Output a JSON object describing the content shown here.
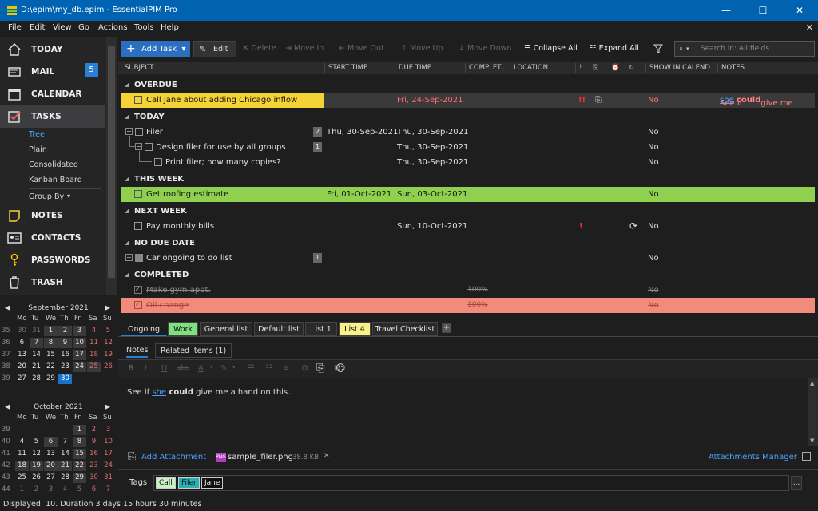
{
  "window": {
    "title": "D:\\epim\\my_db.epim - EssentialPIM Pro",
    "minimize": "—",
    "maximize": "☐",
    "close": "✕"
  },
  "menu": [
    "File",
    "Edit",
    "View",
    "Go",
    "Actions",
    "Tools",
    "Help"
  ],
  "menu_close": "✕",
  "nav": {
    "items": [
      {
        "label": "TODAY",
        "icon": "home-icon"
      },
      {
        "label": "MAIL",
        "icon": "mail-icon",
        "badge": "5"
      },
      {
        "label": "CALENDAR",
        "icon": "calendar-icon",
        "icon_text": "30"
      },
      {
        "label": "TASKS",
        "icon": "tasks-icon"
      },
      {
        "label": "NOTES",
        "icon": "notes-icon"
      },
      {
        "label": "CONTACTS",
        "icon": "contacts-icon"
      },
      {
        "label": "PASSWORDS",
        "icon": "key-icon"
      },
      {
        "label": "TRASH",
        "icon": "trash-icon"
      }
    ],
    "task_views": [
      "Tree",
      "Plain",
      "Consolidated",
      "Kanban Board"
    ],
    "group_by": "Group By",
    "group_by_arrow": "▾"
  },
  "calendars": [
    {
      "title": "September  2021",
      "dow": [
        "Mo",
        "Tu",
        "We",
        "Th",
        "Fr",
        "Sa",
        "Su"
      ],
      "weeks": [
        {
          "n": "35",
          "days": [
            "30",
            "31",
            "1",
            "2",
            "3",
            "4",
            "5"
          ]
        },
        {
          "n": "36",
          "days": [
            "6",
            "7",
            "8",
            "9",
            "10",
            "11",
            "12"
          ]
        },
        {
          "n": "37",
          "days": [
            "13",
            "14",
            "15",
            "16",
            "17",
            "18",
            "19"
          ]
        },
        {
          "n": "38",
          "days": [
            "20",
            "21",
            "22",
            "23",
            "24",
            "25",
            "26"
          ]
        },
        {
          "n": "39",
          "days": [
            "27",
            "28",
            "29",
            "30",
            "",
            "",
            ""
          ]
        }
      ]
    },
    {
      "title": "October  2021",
      "dow": [
        "Mo",
        "Tu",
        "We",
        "Th",
        "Fr",
        "Sa",
        "Su"
      ],
      "weeks": [
        {
          "n": "39",
          "days": [
            "",
            "",
            "",
            "",
            "1",
            "2",
            "3"
          ]
        },
        {
          "n": "40",
          "days": [
            "4",
            "5",
            "6",
            "7",
            "8",
            "9",
            "10"
          ]
        },
        {
          "n": "41",
          "days": [
            "11",
            "12",
            "13",
            "14",
            "15",
            "16",
            "17"
          ]
        },
        {
          "n": "42",
          "days": [
            "18",
            "19",
            "20",
            "21",
            "22",
            "23",
            "24"
          ]
        },
        {
          "n": "43",
          "days": [
            "25",
            "26",
            "27",
            "28",
            "29",
            "30",
            "31"
          ]
        },
        {
          "n": "44",
          "days": [
            "1",
            "2",
            "3",
            "4",
            "5",
            "6",
            "7"
          ]
        }
      ]
    }
  ],
  "cal_nav": {
    "prev": "◀",
    "next": "▶"
  },
  "toolbar": {
    "add_task": "Add Task",
    "dropdown": "▾",
    "edit": "Edit",
    "delete": "Delete",
    "move_in": "Move In",
    "move_out": "Move Out",
    "move_up": "Move Up",
    "move_down": "Move Down",
    "collapse_all": "Collapse All",
    "expand_all": "Expand All",
    "search_placeholder": "Search in: All fields"
  },
  "columns": [
    "SUBJECT",
    "START TIME",
    "DUE TIME",
    "COMPLET...",
    "LOCATION",
    "SHOW IN CALEND...",
    "NOTES"
  ],
  "groups": {
    "overdue": "OVERDUE",
    "today": "TODAY",
    "this_week": "THIS WEEK",
    "next_week": "NEXT WEEK",
    "no_due": "NO DUE DATE",
    "completed": "COMPLETED"
  },
  "group_arrow": "◢",
  "tasks": {
    "t1": {
      "subject": "Call Jane about adding Chicago inflow",
      "due": "Fri, 24-Sep-2021",
      "priority": "!!",
      "show": "No",
      "notes_a": "See if",
      "notes_b": "she",
      "notes_c": "could",
      "notes_d": "give me"
    },
    "t2": {
      "subject": "Filer",
      "count": "2",
      "start": "Thu, 30-Sep-2021",
      "due": "Thu, 30-Sep-2021",
      "show": "No"
    },
    "t3": {
      "subject": "Design filer for use by all groups",
      "count": "1",
      "due": "Thu, 30-Sep-2021",
      "show": "No"
    },
    "t4": {
      "subject": "Print filer; how many copies?",
      "due": "Thu, 30-Sep-2021",
      "show": "No"
    },
    "t5": {
      "subject": "Get roofing estimate",
      "start": "Fri, 01-Oct-2021",
      "due": "Sun, 03-Oct-2021",
      "show": "No"
    },
    "t6": {
      "subject": "Pay monthly bills",
      "due": "Sun, 10-Oct-2021",
      "priority": "!",
      "recur": "⟳",
      "show": "No"
    },
    "t7": {
      "subject": "Car ongoing to do list",
      "count": "1",
      "show": "No"
    },
    "t8": {
      "subject": "Make gym appt.",
      "completed": "100%",
      "show": "No"
    },
    "t9": {
      "subject": "Oil change",
      "completed": "100%",
      "show": "No"
    }
  },
  "expander": {
    "collapse": "−",
    "expand": "+"
  },
  "list_tabs": [
    "Ongoing",
    "Work",
    "General list",
    "Default list",
    "List 1",
    "List 4",
    "Travel Checklist",
    "+"
  ],
  "note_tabs": [
    "Notes",
    "Related Items  (1)"
  ],
  "format_icons": [
    "B",
    "I",
    "U",
    "abc",
    "A",
    "▾",
    "✎",
    "▾",
    "☰",
    "☷",
    "≡",
    "⧉",
    "⊡",
    "⊞"
  ],
  "note": {
    "a": "See if ",
    "b": "she",
    "c": " could",
    "d": " give me a hand on this.."
  },
  "attachments": {
    "add": "Add Attachment",
    "file": "sample_filer.png",
    "size": "38.8 KB",
    "remove": "✕",
    "manager": "Attachments Manager",
    "file_icon_text": "PNG"
  },
  "tags": {
    "label": "Tags",
    "items": [
      "Call",
      "Filer",
      "Jane"
    ],
    "more": "..."
  },
  "status": "Displayed: 10. Duration 3 days 15 hours 30 minutes",
  "colors": {
    "accent": "#2a7fd4",
    "overdue_row": "#f5d235",
    "week_row": "#8fd14f",
    "completed_row": "#f28b7b",
    "red": "#e04040"
  }
}
